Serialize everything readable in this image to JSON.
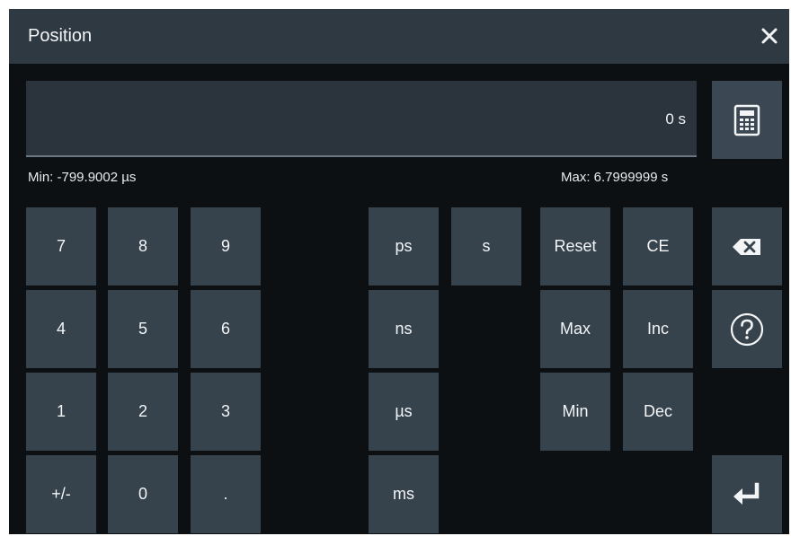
{
  "dialog": {
    "title": "Position",
    "entry_value": "0 s",
    "min_label": "Min: -799.9002 µs",
    "max_label": "Max: 6.7999999 s"
  },
  "digits": {
    "seven": "7",
    "eight": "8",
    "nine": "9",
    "four": "4",
    "five": "5",
    "six": "6",
    "one": "1",
    "two": "2",
    "three": "3",
    "sign": "+/-",
    "zero": "0",
    "decimal": "."
  },
  "units": {
    "ps": "ps",
    "s": "s",
    "ns": "ns",
    "us": "µs",
    "ms": "ms"
  },
  "functions": {
    "reset": "Reset",
    "ce": "CE",
    "max": "Max",
    "inc": "Inc",
    "min": "Min",
    "dec": "Dec"
  },
  "icons": {
    "close": "close-icon",
    "calculator": "calculator-icon",
    "backspace": "backspace-icon",
    "help": "help-icon",
    "enter": "enter-icon"
  }
}
